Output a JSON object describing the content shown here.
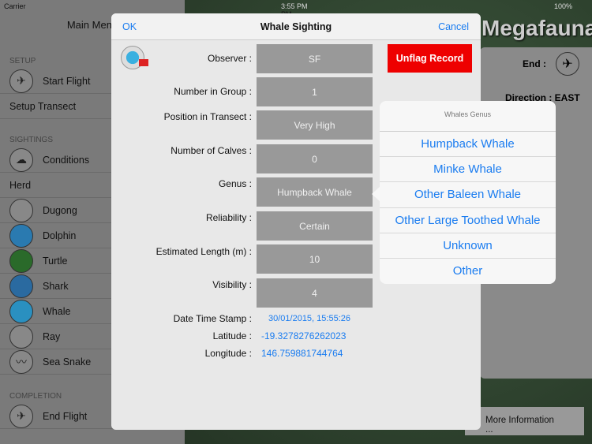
{
  "status_bar": {
    "carrier": "Carrier",
    "time": "3:55 PM",
    "battery": "100%"
  },
  "sidebar": {
    "title": "Main Menu",
    "sections": {
      "setup": "SETUP",
      "sightings": "SIGHTINGS",
      "completion": "COMPLETION"
    },
    "items": {
      "start_flight": "Start Flight",
      "setup_transect": "Setup Transect",
      "conditions": "Conditions",
      "herd": "Herd",
      "dugong": "Dugong",
      "dolphin": "Dolphin",
      "turtle": "Turtle",
      "shark": "Shark",
      "whale": "Whale",
      "ray": "Ray",
      "sea_snake": "Sea Snake",
      "end_flight": "End Flight"
    }
  },
  "background": {
    "app_title": "Megafauna",
    "end_label": "End :",
    "direction": "Direction : EAST",
    "more_info": "More Information ..."
  },
  "dialog": {
    "title": "Whale Sighting",
    "ok": "OK",
    "cancel": "Cancel",
    "unflag": "Unflag Record",
    "fields": {
      "observer": {
        "label": "Observer :",
        "value": "SF"
      },
      "group": {
        "label": "Number in Group :",
        "value": "1"
      },
      "position": {
        "label": "Position in Transect :",
        "value": "Very High"
      },
      "calves": {
        "label": "Number of Calves :",
        "value": "0"
      },
      "genus": {
        "label": "Genus :",
        "value": "Humpback Whale"
      },
      "reliability": {
        "label": "Reliability :",
        "value": "Certain"
      },
      "length": {
        "label": "Estimated Length (m) :",
        "value": "10"
      },
      "visibility": {
        "label": "Visibility :",
        "value": "4"
      },
      "datetime": {
        "label": "Date Time Stamp :",
        "value": "30/01/2015, 15:55:26"
      },
      "latitude": {
        "label": "Latitude :",
        "value": "-19.3278276262023"
      },
      "longitude": {
        "label": "Longitude :",
        "value": "146.759881744764"
      }
    }
  },
  "popover": {
    "title": "Whales Genus",
    "options": [
      "Humpback Whale",
      "Minke Whale",
      "Other Baleen Whale",
      "Other Large Toothed Whale",
      "Unknown",
      "Other"
    ]
  },
  "colors": {
    "accent": "#1a7cf0",
    "unflag": "#ee0000"
  }
}
